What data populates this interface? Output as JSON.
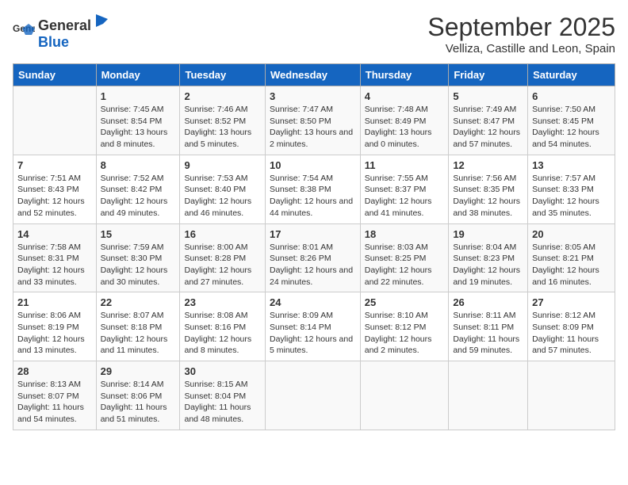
{
  "header": {
    "logo_general": "General",
    "logo_blue": "Blue",
    "title": "September 2025",
    "subtitle": "Velliza, Castille and Leon, Spain"
  },
  "columns": [
    "Sunday",
    "Monday",
    "Tuesday",
    "Wednesday",
    "Thursday",
    "Friday",
    "Saturday"
  ],
  "weeks": [
    [
      {
        "day": "",
        "sunrise": "",
        "sunset": "",
        "daylight": ""
      },
      {
        "day": "1",
        "sunrise": "Sunrise: 7:45 AM",
        "sunset": "Sunset: 8:54 PM",
        "daylight": "Daylight: 13 hours and 8 minutes."
      },
      {
        "day": "2",
        "sunrise": "Sunrise: 7:46 AM",
        "sunset": "Sunset: 8:52 PM",
        "daylight": "Daylight: 13 hours and 5 minutes."
      },
      {
        "day": "3",
        "sunrise": "Sunrise: 7:47 AM",
        "sunset": "Sunset: 8:50 PM",
        "daylight": "Daylight: 13 hours and 2 minutes."
      },
      {
        "day": "4",
        "sunrise": "Sunrise: 7:48 AM",
        "sunset": "Sunset: 8:49 PM",
        "daylight": "Daylight: 13 hours and 0 minutes."
      },
      {
        "day": "5",
        "sunrise": "Sunrise: 7:49 AM",
        "sunset": "Sunset: 8:47 PM",
        "daylight": "Daylight: 12 hours and 57 minutes."
      },
      {
        "day": "6",
        "sunrise": "Sunrise: 7:50 AM",
        "sunset": "Sunset: 8:45 PM",
        "daylight": "Daylight: 12 hours and 54 minutes."
      }
    ],
    [
      {
        "day": "7",
        "sunrise": "Sunrise: 7:51 AM",
        "sunset": "Sunset: 8:43 PM",
        "daylight": "Daylight: 12 hours and 52 minutes."
      },
      {
        "day": "8",
        "sunrise": "Sunrise: 7:52 AM",
        "sunset": "Sunset: 8:42 PM",
        "daylight": "Daylight: 12 hours and 49 minutes."
      },
      {
        "day": "9",
        "sunrise": "Sunrise: 7:53 AM",
        "sunset": "Sunset: 8:40 PM",
        "daylight": "Daylight: 12 hours and 46 minutes."
      },
      {
        "day": "10",
        "sunrise": "Sunrise: 7:54 AM",
        "sunset": "Sunset: 8:38 PM",
        "daylight": "Daylight: 12 hours and 44 minutes."
      },
      {
        "day": "11",
        "sunrise": "Sunrise: 7:55 AM",
        "sunset": "Sunset: 8:37 PM",
        "daylight": "Daylight: 12 hours and 41 minutes."
      },
      {
        "day": "12",
        "sunrise": "Sunrise: 7:56 AM",
        "sunset": "Sunset: 8:35 PM",
        "daylight": "Daylight: 12 hours and 38 minutes."
      },
      {
        "day": "13",
        "sunrise": "Sunrise: 7:57 AM",
        "sunset": "Sunset: 8:33 PM",
        "daylight": "Daylight: 12 hours and 35 minutes."
      }
    ],
    [
      {
        "day": "14",
        "sunrise": "Sunrise: 7:58 AM",
        "sunset": "Sunset: 8:31 PM",
        "daylight": "Daylight: 12 hours and 33 minutes."
      },
      {
        "day": "15",
        "sunrise": "Sunrise: 7:59 AM",
        "sunset": "Sunset: 8:30 PM",
        "daylight": "Daylight: 12 hours and 30 minutes."
      },
      {
        "day": "16",
        "sunrise": "Sunrise: 8:00 AM",
        "sunset": "Sunset: 8:28 PM",
        "daylight": "Daylight: 12 hours and 27 minutes."
      },
      {
        "day": "17",
        "sunrise": "Sunrise: 8:01 AM",
        "sunset": "Sunset: 8:26 PM",
        "daylight": "Daylight: 12 hours and 24 minutes."
      },
      {
        "day": "18",
        "sunrise": "Sunrise: 8:03 AM",
        "sunset": "Sunset: 8:25 PM",
        "daylight": "Daylight: 12 hours and 22 minutes."
      },
      {
        "day": "19",
        "sunrise": "Sunrise: 8:04 AM",
        "sunset": "Sunset: 8:23 PM",
        "daylight": "Daylight: 12 hours and 19 minutes."
      },
      {
        "day": "20",
        "sunrise": "Sunrise: 8:05 AM",
        "sunset": "Sunset: 8:21 PM",
        "daylight": "Daylight: 12 hours and 16 minutes."
      }
    ],
    [
      {
        "day": "21",
        "sunrise": "Sunrise: 8:06 AM",
        "sunset": "Sunset: 8:19 PM",
        "daylight": "Daylight: 12 hours and 13 minutes."
      },
      {
        "day": "22",
        "sunrise": "Sunrise: 8:07 AM",
        "sunset": "Sunset: 8:18 PM",
        "daylight": "Daylight: 12 hours and 11 minutes."
      },
      {
        "day": "23",
        "sunrise": "Sunrise: 8:08 AM",
        "sunset": "Sunset: 8:16 PM",
        "daylight": "Daylight: 12 hours and 8 minutes."
      },
      {
        "day": "24",
        "sunrise": "Sunrise: 8:09 AM",
        "sunset": "Sunset: 8:14 PM",
        "daylight": "Daylight: 12 hours and 5 minutes."
      },
      {
        "day": "25",
        "sunrise": "Sunrise: 8:10 AM",
        "sunset": "Sunset: 8:12 PM",
        "daylight": "Daylight: 12 hours and 2 minutes."
      },
      {
        "day": "26",
        "sunrise": "Sunrise: 8:11 AM",
        "sunset": "Sunset: 8:11 PM",
        "daylight": "Daylight: 11 hours and 59 minutes."
      },
      {
        "day": "27",
        "sunrise": "Sunrise: 8:12 AM",
        "sunset": "Sunset: 8:09 PM",
        "daylight": "Daylight: 11 hours and 57 minutes."
      }
    ],
    [
      {
        "day": "28",
        "sunrise": "Sunrise: 8:13 AM",
        "sunset": "Sunset: 8:07 PM",
        "daylight": "Daylight: 11 hours and 54 minutes."
      },
      {
        "day": "29",
        "sunrise": "Sunrise: 8:14 AM",
        "sunset": "Sunset: 8:06 PM",
        "daylight": "Daylight: 11 hours and 51 minutes."
      },
      {
        "day": "30",
        "sunrise": "Sunrise: 8:15 AM",
        "sunset": "Sunset: 8:04 PM",
        "daylight": "Daylight: 11 hours and 48 minutes."
      },
      {
        "day": "",
        "sunrise": "",
        "sunset": "",
        "daylight": ""
      },
      {
        "day": "",
        "sunrise": "",
        "sunset": "",
        "daylight": ""
      },
      {
        "day": "",
        "sunrise": "",
        "sunset": "",
        "daylight": ""
      },
      {
        "day": "",
        "sunrise": "",
        "sunset": "",
        "daylight": ""
      }
    ]
  ]
}
